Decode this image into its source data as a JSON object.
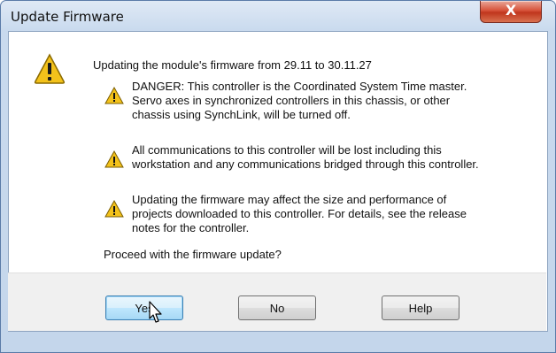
{
  "window": {
    "title": "Update Firmware",
    "close_label": "X"
  },
  "dialog": {
    "heading": "Updating the module's firmware from 29.11 to 30.11.27",
    "warnings": [
      {
        "icon": "warning-icon",
        "lines": [
          "DANGER: This controller is the Coordinated System Time master.",
          "Servo axes in synchronized controllers in this chassis, or other",
          "chassis using SynchLink, will be turned off."
        ]
      },
      {
        "icon": "warning-icon",
        "lines": [
          "All communications to this controller will be lost including this",
          "workstation and any communications bridged through this controller."
        ]
      },
      {
        "icon": "warning-icon",
        "lines": [
          "Updating the firmware may affect the size and performance of",
          "projects downloaded to this controller.  For details, see the release",
          "notes for the controller."
        ]
      }
    ],
    "question": "Proceed with the firmware update?"
  },
  "buttons": {
    "yes": "Yes",
    "no": "No",
    "help": "Help"
  },
  "colors": {
    "warning_fill": "#f3c21b",
    "titlebar": "#c9daee",
    "close_button": "#c9432a"
  }
}
